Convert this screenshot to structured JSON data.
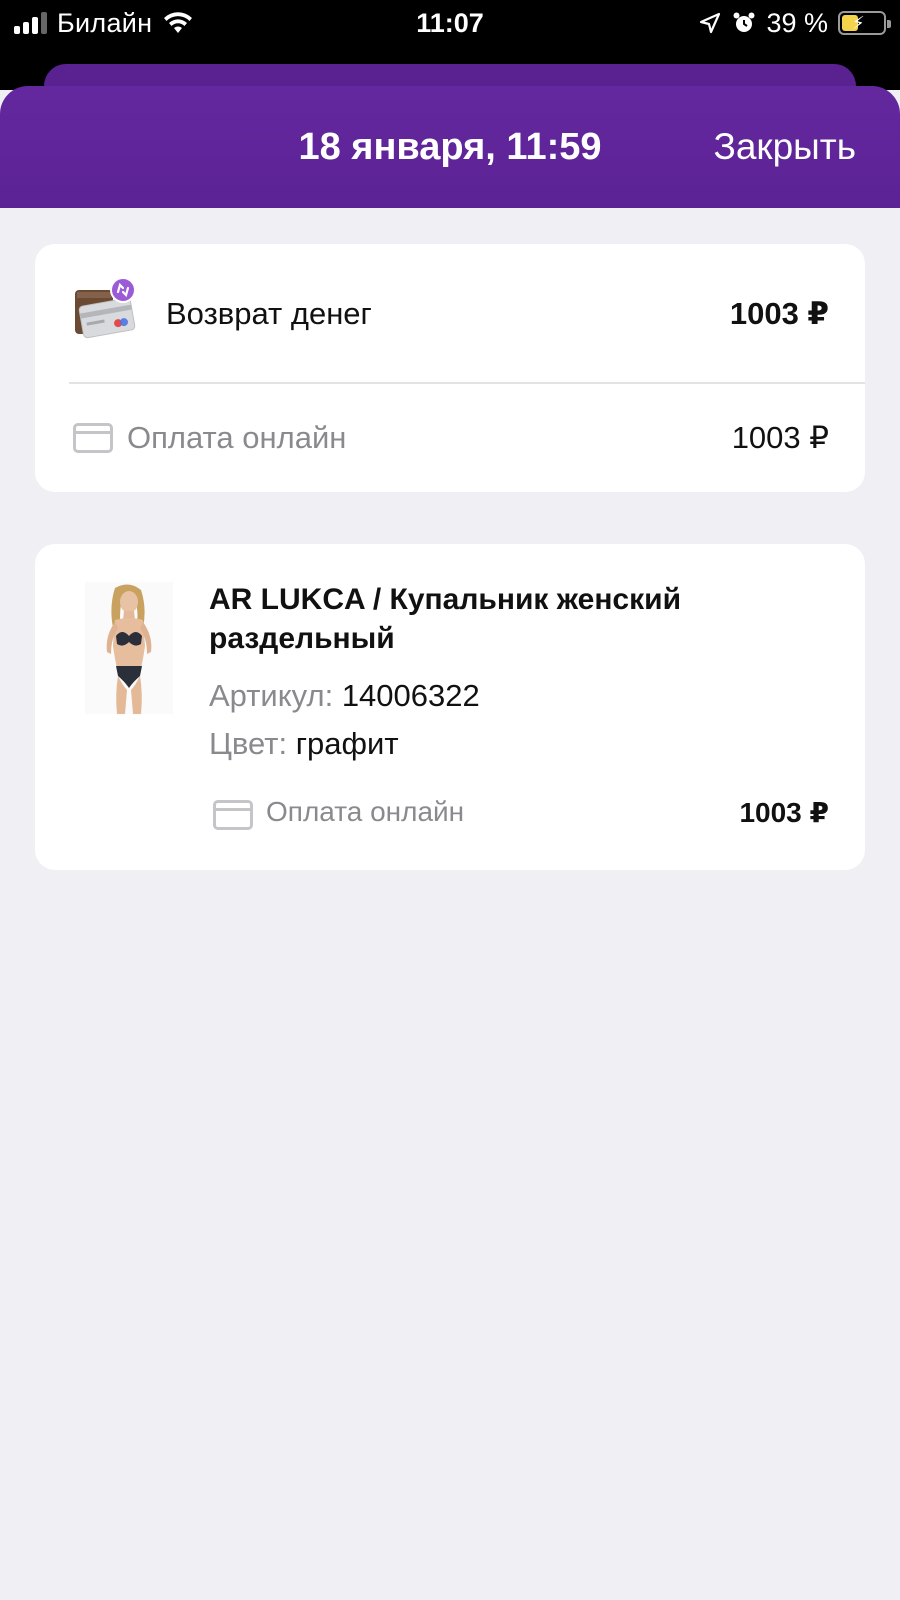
{
  "status_bar": {
    "carrier": "Билайн",
    "time": "11:07",
    "battery_percent": "39 %",
    "battery_level": 0.39,
    "signal_bars": 3
  },
  "sheet": {
    "title": "18 января, 11:59",
    "close_label": "Закрыть"
  },
  "refund": {
    "label": "Возврат денег",
    "amount": "1003 ₽",
    "payment_label": "Оплата онлайн",
    "payment_amount": "1003 ₽"
  },
  "product": {
    "title": "AR LUKCA / Купальник женский раздельный",
    "article_key": "Артикул:",
    "article_value": "14006322",
    "color_key": "Цвет:",
    "color_value": "графит",
    "payment_label": "Оплата онлайн",
    "payment_amount": "1003 ₽"
  },
  "colors": {
    "accent": "#5b2295",
    "background": "#f0eff4",
    "muted_text": "#8a8a8e",
    "refund_badge": "#9b5bd6"
  },
  "icons": [
    "signal-icon",
    "wifi-icon",
    "location-icon",
    "alarm-icon",
    "battery-icon",
    "refund-wallet-icon",
    "credit-card-icon"
  ]
}
